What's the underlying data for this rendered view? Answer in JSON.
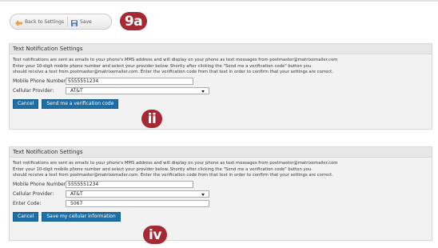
{
  "toolbar": {
    "back_label": "Back to Settings",
    "save_label": "Save"
  },
  "badges": [
    "9a",
    "ii",
    "iv"
  ],
  "panel1": {
    "title": "Text Notification Settings",
    "lines": [
      "Text notifications are sent as emails to your phone's MMS address and will display on your phone as text messages from postmaster@matrixemailer.com",
      "Enter your 10-digit mobile phone number and select your provider below. Shortly after clicking the \"Send me a verification code\" button you",
      "should receive a text from postmaster@matrixemailer.com. Enter the verification code from that text in order to confirm that your settings are correct."
    ],
    "phone_label": "Mobile Phone Number:",
    "phone_value": "5555551234",
    "provider_label": "Cellular Provider:",
    "provider_value": "AT&T",
    "cancel_label": "Cancel",
    "action_label": "Send me a verification code"
  },
  "panel2": {
    "title": "Text Notification Settings",
    "lines": [
      "Text notifications are sent as emails to your phone's MMS address and will display on your phone as text messages from postmaster@matrixemailer.com",
      "Enter your 10-digit mobile phone number and select your provider below. Shortly after clicking the \"Send me a verification code\" button you",
      "should receive a text from postmaster@matrixemailer.com. Enter the verification code from that text in order to confirm that your settings are correct."
    ],
    "phone_label": "Mobile Phone Number:",
    "phone_value": "5555551234",
    "provider_label": "Cellular Provider:",
    "provider_value": "AT&T",
    "code_label": "Enter Code:",
    "code_value": "5067",
    "cancel_label": "Cancel",
    "action_label": "Save my cellular information"
  },
  "colors": {
    "accent_button": "#1d6fa5",
    "badge": "#a62833"
  },
  "icons": [
    "arrow-back-icon",
    "floppy-save-icon"
  ]
}
